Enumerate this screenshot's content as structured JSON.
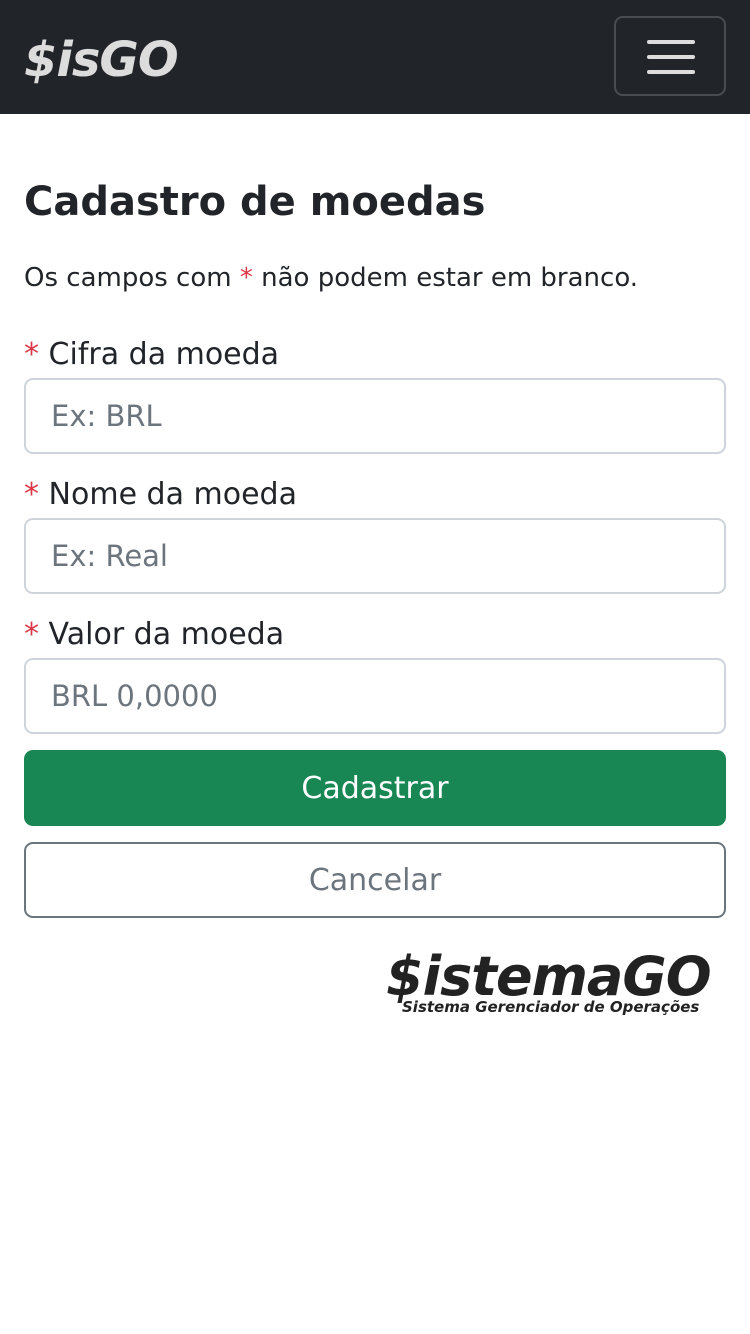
{
  "navbar": {
    "brand": "$isGO",
    "menu_icon": "hamburger-menu-icon"
  },
  "form": {
    "title": "Cadastro de moedas",
    "notice_prefix": "Os campos com ",
    "required_mark": "*",
    "notice_suffix": " não podem estar em branco.",
    "fields": [
      {
        "label": "Cifra da moeda",
        "placeholder": "Ex: BRL",
        "value": ""
      },
      {
        "label": "Nome da moeda",
        "placeholder": "Ex: Real",
        "value": ""
      },
      {
        "label": "Valor da moeda",
        "placeholder": "BRL 0,0000",
        "value": ""
      }
    ],
    "submit_label": "Cadastrar",
    "cancel_label": "Cancelar"
  },
  "footer": {
    "logo_title": "$istemaGO",
    "logo_subtitle": "Sistema Gerenciador de Operações"
  },
  "colors": {
    "navbar_bg": "#212529",
    "primary_button": "#198754",
    "required_mark": "#dc3545",
    "muted": "#6c757d"
  }
}
